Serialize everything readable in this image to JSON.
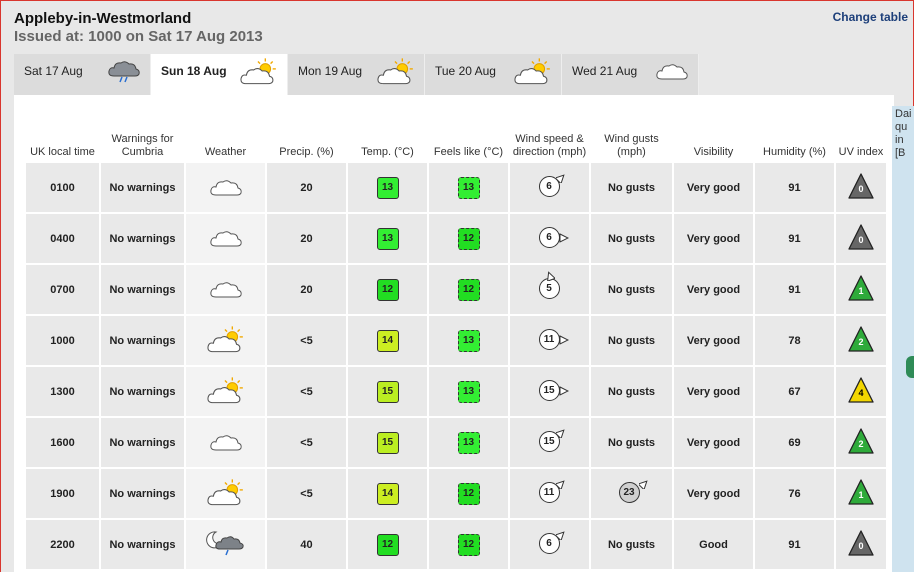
{
  "location": "Appleby-in-Westmorland",
  "issued": "Issued at: 1000 on Sat 17 Aug 2013",
  "change_table": "Change table",
  "tabs": [
    {
      "label": "Sat 17 Aug",
      "icon": "cloud-rain-icon",
      "active": false
    },
    {
      "label": "Sun 18 Aug",
      "icon": "sun-cloud-icon",
      "active": true
    },
    {
      "label": "Mon 19 Aug",
      "icon": "sun-cloud-icon",
      "active": false
    },
    {
      "label": "Tue 20 Aug",
      "icon": "sun-cloud-icon",
      "active": false
    },
    {
      "label": "Wed 21 Aug",
      "icon": "cloud-icon",
      "active": false
    }
  ],
  "headers": {
    "time": "UK local time",
    "warnings": "Warnings for Cumbria",
    "weather": "Weather",
    "precip": "Precip. (%)",
    "temp": "Temp. (°C)",
    "feels": "Feels like (°C)",
    "wind": "Wind speed & direction (mph)",
    "gusts": "Wind gusts (mph)",
    "visibility": "Visibility",
    "humidity": "Humidity (%)",
    "uv": "UV index"
  },
  "side_text": "Dai qu in [B",
  "colors": {
    "t12": "#22dd22",
    "t13": "#33ee33",
    "t14": "#ccee22",
    "t15": "#bbee22",
    "uv0": "#666666",
    "uv1": "#2eaa3a",
    "uv2": "#2eaa3a",
    "uv4": "#f2d600"
  },
  "rows": [
    {
      "time": "0100",
      "warning": "No warnings",
      "weather": "cloud-icon",
      "precip": "20",
      "temp": "13",
      "feels": "13",
      "wind": "6",
      "wind_dir": "ne",
      "gust": "No gusts",
      "visibility": "Very good",
      "humidity": "91",
      "uv": "0"
    },
    {
      "time": "0400",
      "warning": "No warnings",
      "weather": "cloud-icon",
      "precip": "20",
      "temp": "13",
      "feels": "12",
      "wind": "6",
      "wind_dir": "e",
      "gust": "No gusts",
      "visibility": "Very good",
      "humidity": "91",
      "uv": "0"
    },
    {
      "time": "0700",
      "warning": "No warnings",
      "weather": "cloud-icon",
      "precip": "20",
      "temp": "12",
      "feels": "12",
      "wind": "5",
      "wind_dir": "n",
      "gust": "No gusts",
      "visibility": "Very good",
      "humidity": "91",
      "uv": "1"
    },
    {
      "time": "1000",
      "warning": "No warnings",
      "weather": "sun-cloud-icon",
      "precip": "<5",
      "temp": "14",
      "feels": "13",
      "wind": "11",
      "wind_dir": "e",
      "gust": "No gusts",
      "visibility": "Very good",
      "humidity": "78",
      "uv": "2"
    },
    {
      "time": "1300",
      "warning": "No warnings",
      "weather": "sun-cloud-icon",
      "precip": "<5",
      "temp": "15",
      "feels": "13",
      "wind": "15",
      "wind_dir": "e",
      "gust": "No gusts",
      "visibility": "Very good",
      "humidity": "67",
      "uv": "4"
    },
    {
      "time": "1600",
      "warning": "No warnings",
      "weather": "cloud-icon",
      "precip": "<5",
      "temp": "15",
      "feels": "13",
      "wind": "15",
      "wind_dir": "ne",
      "gust": "No gusts",
      "visibility": "Very good",
      "humidity": "69",
      "uv": "2"
    },
    {
      "time": "1900",
      "warning": "No warnings",
      "weather": "sun-cloud-icon",
      "precip": "<5",
      "temp": "14",
      "feels": "12",
      "wind": "11",
      "wind_dir": "ne",
      "gust": "23",
      "visibility": "Very good",
      "humidity": "76",
      "uv": "1"
    },
    {
      "time": "2200",
      "warning": "No warnings",
      "weather": "moon-cloud-rain-icon",
      "precip": "40",
      "temp": "12",
      "feels": "12",
      "wind": "6",
      "wind_dir": "ne",
      "gust": "No gusts",
      "visibility": "Good",
      "humidity": "91",
      "uv": "0"
    }
  ]
}
